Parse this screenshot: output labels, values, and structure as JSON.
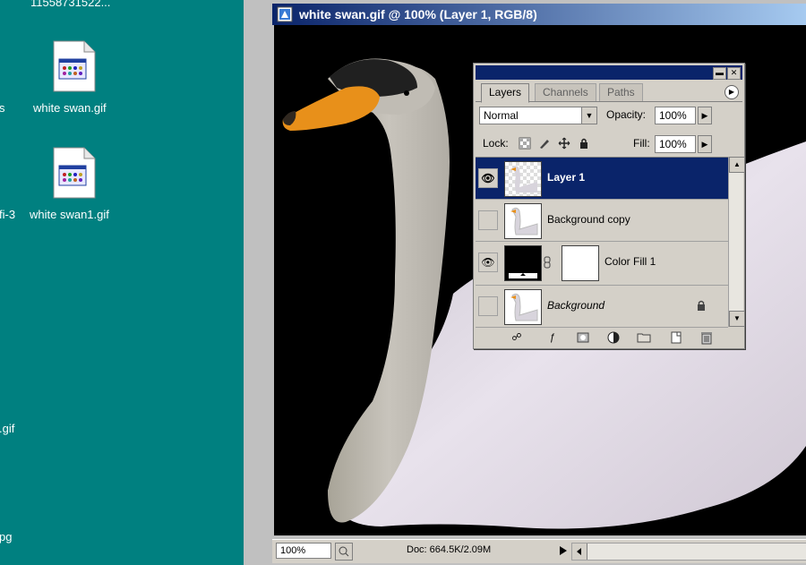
{
  "desktop": {
    "icons": [
      {
        "label": "11558731522..."
      },
      {
        "label": "white swan.gif"
      },
      {
        "label": "white swan1.gif"
      }
    ],
    "partial_labels": [
      "s",
      "fi-3",
      ".gif",
      "pg"
    ]
  },
  "document": {
    "title": "white swan.gif @ 100% (Layer 1, RGB/8)",
    "zoom": "100%",
    "doc_info": "Doc: 664.5K/2.09M"
  },
  "layers_palette": {
    "tabs": [
      "Layers",
      "Channels",
      "Paths"
    ],
    "blend_mode": "Normal",
    "opacity_label": "Opacity:",
    "opacity": "100%",
    "lock_label": "Lock:",
    "fill_label": "Fill:",
    "fill": "100%",
    "layers": [
      {
        "name": "Layer 1",
        "visible": true,
        "selected": true
      },
      {
        "name": "Background copy",
        "visible": false,
        "selected": false
      },
      {
        "name": "Color Fill 1",
        "visible": true,
        "selected": false
      },
      {
        "name": "Background",
        "visible": false,
        "selected": false,
        "locked": true
      }
    ]
  },
  "colors": {
    "desktop": "#008080",
    "titlebar": "#0a246a",
    "selection": "#0a246a"
  }
}
